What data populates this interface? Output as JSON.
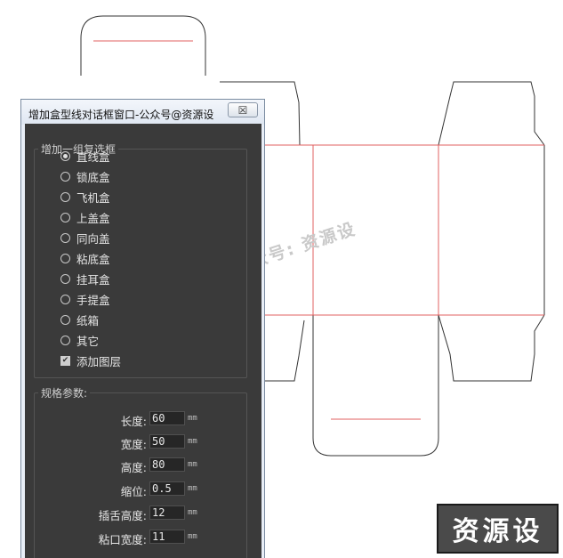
{
  "dialog": {
    "title": "增加盒型线对话框窗口-公众号@资源设",
    "close_glyph": "☒"
  },
  "box_type_group": {
    "legend": "增加一组复选框",
    "options": [
      {
        "label": "直线盒",
        "selected": true
      },
      {
        "label": "锁底盒",
        "selected": false
      },
      {
        "label": "飞机盒",
        "selected": false
      },
      {
        "label": "上盖盒",
        "selected": false
      },
      {
        "label": "同向盖",
        "selected": false
      },
      {
        "label": "粘底盒",
        "selected": false
      },
      {
        "label": "挂耳盒",
        "selected": false
      },
      {
        "label": "手提盒",
        "selected": false
      },
      {
        "label": "纸箱",
        "selected": false
      },
      {
        "label": "其它",
        "selected": false
      }
    ],
    "add_layer": {
      "label": "添加图层",
      "checked": true
    }
  },
  "spec_group": {
    "legend": "规格参数:",
    "params": [
      {
        "label": "长度:",
        "value": "60",
        "unit": "mm"
      },
      {
        "label": "宽度:",
        "value": "50",
        "unit": "mm"
      },
      {
        "label": "高度:",
        "value": "80",
        "unit": "mm"
      },
      {
        "label": "缩位:",
        "value": "0.5",
        "unit": "mm"
      },
      {
        "label": "插舌高度:",
        "value": "12",
        "unit": "mm"
      },
      {
        "label": "粘口宽度:",
        "value": "11",
        "unit": "mm"
      }
    ]
  },
  "watermark": "微信公众号: 资源设",
  "brand_badge": "资源设",
  "colors": {
    "panel_bg": "#3a3a3a",
    "cut_line": "#333333",
    "fold_line": "#e06060"
  }
}
